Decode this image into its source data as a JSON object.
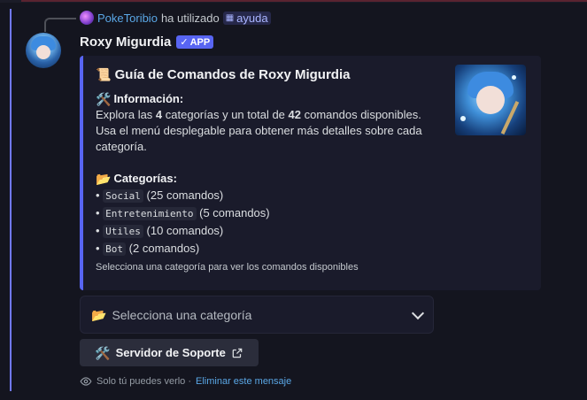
{
  "reply": {
    "user": "PokeToribio",
    "action": "ha utilizado",
    "command": "ayuda"
  },
  "message": {
    "username": "Roxy Migurdia",
    "badge": "APP"
  },
  "embed": {
    "title_emoji": "📜",
    "title": "Guía de Comandos de Roxy Migurdia",
    "info_emoji": "🛠️",
    "info_label": "Información:",
    "info_pre": "Explora las ",
    "info_categories": "4",
    "info_mid": " categorías y un total de ",
    "info_commands": "42",
    "info_post": " comandos disponibles.",
    "info_line2": "Usa el menú desplegable para obtener más detalles sobre cada categoría.",
    "categories_emoji": "📂",
    "categories_label": "Categorías:",
    "categories": [
      {
        "name": "Social",
        "count": "(25 comandos)"
      },
      {
        "name": "Entretenimiento",
        "count": "(5 comandos)"
      },
      {
        "name": "Utiles",
        "count": "(10 comandos)"
      },
      {
        "name": "Bot",
        "count": "(2 comandos)"
      }
    ],
    "footer": "Selecciona una categoría para ver los comandos disponibles"
  },
  "select_menu": {
    "emoji": "📂",
    "placeholder": "Selecciona una categoría"
  },
  "support_button": {
    "emoji": "🛠️",
    "label": "Servidor de Soporte"
  },
  "ephemeral": {
    "text": "Solo tú puedes verlo · ",
    "link": "Eliminar este mensaje"
  },
  "colors": {
    "accent": "#5865f2",
    "background": "#14151f",
    "embed_bg": "#1a1b2b",
    "link": "#5aa7e6"
  }
}
